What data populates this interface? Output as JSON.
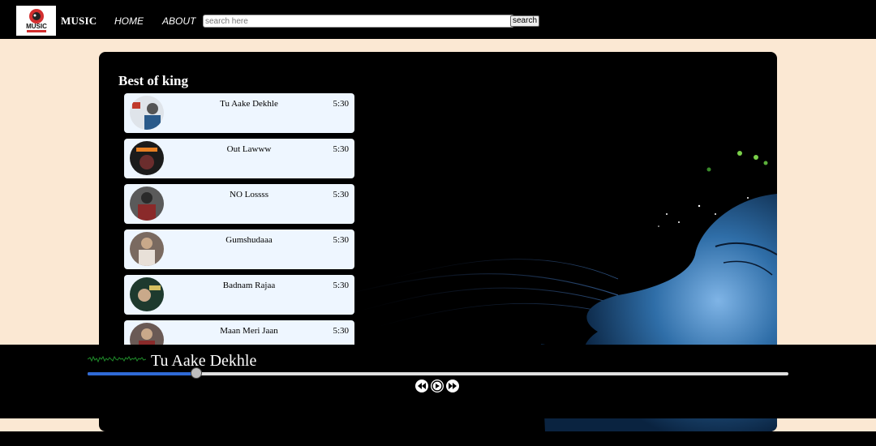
{
  "navbar": {
    "logo_text": "MUSIC",
    "brand": "MUSIC",
    "links": [
      "HOME",
      "ABOUT"
    ],
    "search_placeholder": "search here",
    "search_button": "search"
  },
  "playlist": {
    "title": "Best of king",
    "songs": [
      {
        "name": "Tu Aake Dekhle",
        "duration": "5:30"
      },
      {
        "name": "Out Lawww",
        "duration": "5:30"
      },
      {
        "name": "NO Lossss",
        "duration": "5:30"
      },
      {
        "name": "Gumshudaaa",
        "duration": "5:30"
      },
      {
        "name": "Badnam Rajaa",
        "duration": "5:30"
      },
      {
        "name": "Maan Meri Jaan",
        "duration": "5:30"
      }
    ]
  },
  "player": {
    "now_playing": "Tu Aake Dekhle",
    "progress": 0.155,
    "controls": [
      "previous-icon",
      "play-icon",
      "next-icon"
    ]
  },
  "colors": {
    "page_bg": "#fbe8d3",
    "progress_accent": "#2f6ad6",
    "list_item_bg": "#eef6ff"
  }
}
